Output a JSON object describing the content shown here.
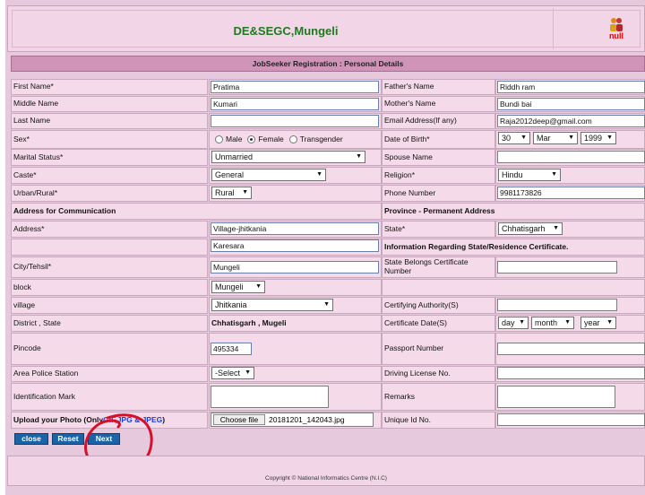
{
  "header": {
    "title": "DE&SEGC,Mungeli",
    "logo_text": "null"
  },
  "section_title": "JobSeeker Registration : Personal Details",
  "labels": {
    "first_name": "First Name*",
    "middle_name": "Middle Name",
    "last_name": "Last Name",
    "sex": "Sex*",
    "marital_status": "Marital Status*",
    "caste": "Caste*",
    "urban_rural": "Urban/Rural*",
    "address_comm": "Address for Communication",
    "address": "Address*",
    "city": "City/Tehsil*",
    "block": "block",
    "village": "village",
    "district_state": "District , State",
    "pincode": "Pincode",
    "police_station": "Area Police Station",
    "id_mark": "Identification Mark",
    "upload_photo_prefix": "Upload your Photo (Only ",
    "upload_photo_types": "GIF,JPG & JPEG",
    "upload_photo_suffix": " )",
    "father_name": "Father's Name",
    "mother_name": "Mother's Name",
    "email": "Email Address(If any)",
    "dob": "Date of Birth*",
    "spouse": "Spouse Name",
    "religion": "Religion*",
    "phone": "Phone Number",
    "province": "Province - Permanent Address",
    "state": "State*",
    "state_residence_info": "Information Regarding State/Residence Certificate.",
    "state_cert_number": "State Belongs Certificate Number",
    "certifying_authority": "Certifying Authority(S)",
    "certificate_date": "Certificate Date(S)",
    "passport": "Passport Number",
    "driving_license": "Driving License No.",
    "remarks": "Remarks",
    "unique_id": "Unique Id No."
  },
  "values": {
    "first_name": "Pratima",
    "middle_name": "Kumari",
    "last_name": "",
    "father_name": "Riddh ram",
    "mother_name": "Bundi bai",
    "email": "Raja2012deep@gmail.com",
    "phone": "9981173826",
    "address_line1": "Village-jhitkania",
    "address_line2": "Karesara",
    "city": "Mungeli",
    "district_state": "Chhatisgarh , Mugeli",
    "pincode": "495334"
  },
  "sex_options": [
    "Male",
    "Female",
    "Transgender"
  ],
  "sex_selected": "Female",
  "selects": {
    "marital_status": "Unmarried",
    "caste": "General",
    "urban_rural": "Rural",
    "dob_day": "30",
    "dob_month": "Mar",
    "dob_year": "1999",
    "religion": "Hindu",
    "state": "Chhatisgarh",
    "block": "Mungeli",
    "village": "Jhitkania",
    "cert_day": "day",
    "cert_month": "month",
    "cert_year": "year",
    "police_station": "-Select"
  },
  "file": {
    "button": "Choose file",
    "name": "20181201_142043.jpg"
  },
  "buttons": {
    "close": "close",
    "reset": "Reset",
    "next": "Next"
  },
  "footer": "Copyright © National Informatics Centre (N.I.C)"
}
